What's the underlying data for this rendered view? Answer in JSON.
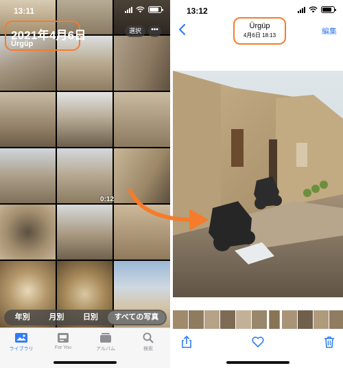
{
  "left_screen": {
    "status_time": "13:11",
    "date_title": "2021年4月6日",
    "location": "Ürgüp",
    "select_label": "選択",
    "more_label": "•••",
    "video_duration": "0:12",
    "view_tabs": [
      {
        "label": "年別",
        "active": false
      },
      {
        "label": "月別",
        "active": false
      },
      {
        "label": "日別",
        "active": false
      },
      {
        "label": "すべての写真",
        "active": true
      }
    ],
    "tab_bar": [
      {
        "label": "ライブラリ",
        "icon": "photo-library-icon",
        "active": true
      },
      {
        "label": "For You",
        "icon": "for-you-icon",
        "active": false
      },
      {
        "label": "アルバム",
        "icon": "albums-icon",
        "active": false
      },
      {
        "label": "検索",
        "icon": "search-icon",
        "active": false
      }
    ]
  },
  "right_screen": {
    "status_time": "13:12",
    "title": "Ürgüp",
    "subtitle": "4月6日 18:13",
    "edit_label": "編集"
  },
  "colors": {
    "accent_orange": "#f57c2b",
    "ios_blue": "#2f7cf6"
  }
}
